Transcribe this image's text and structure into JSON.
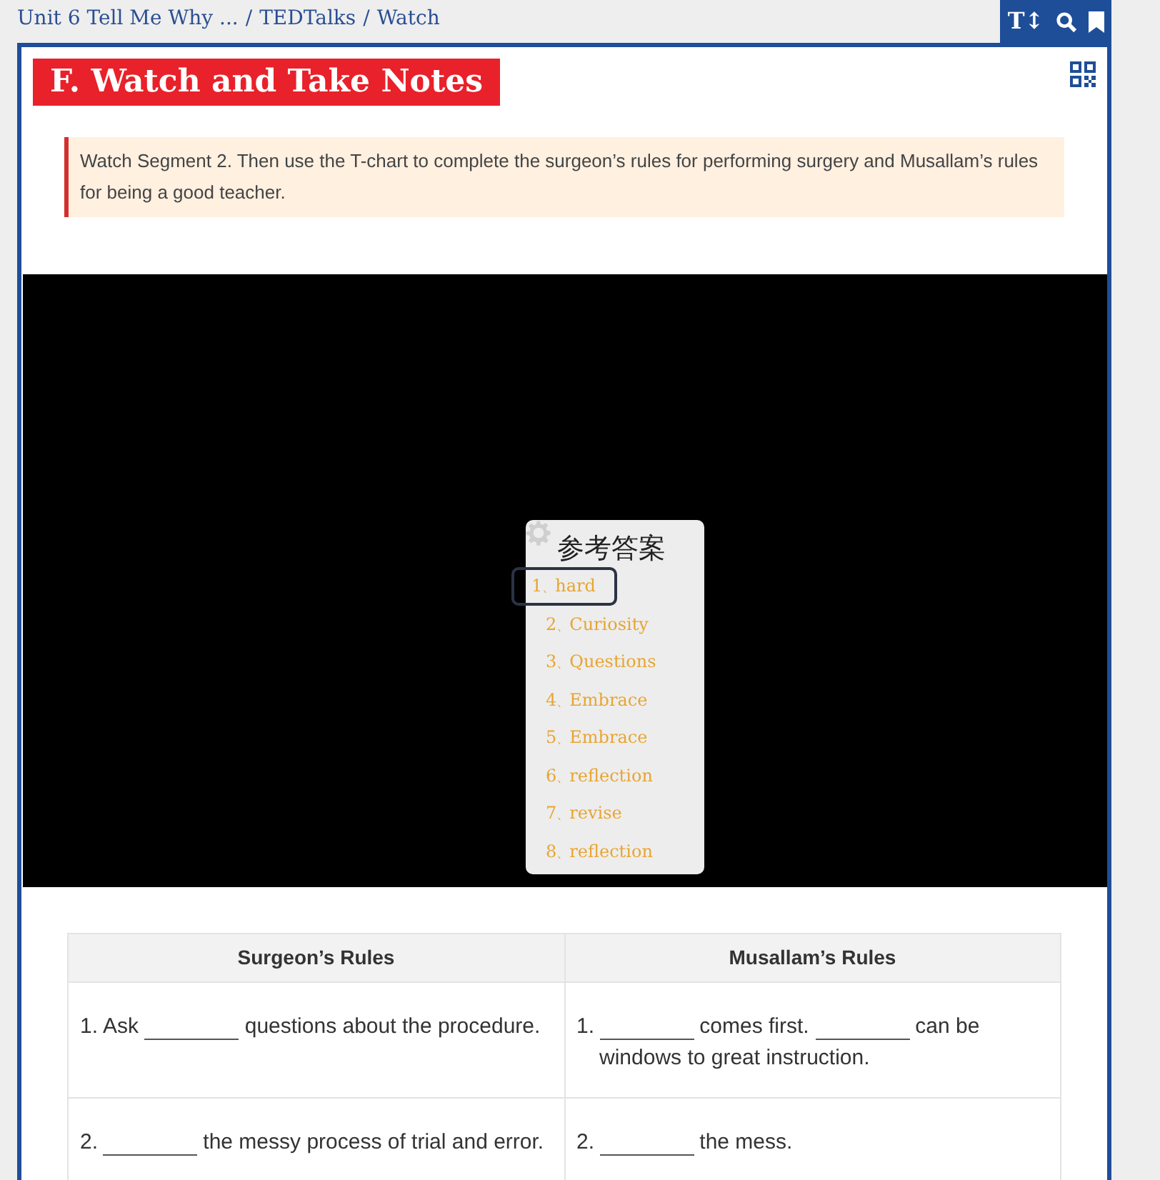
{
  "breadcrumb": [
    {
      "label": "Unit 6 Tell Me Why ..."
    },
    {
      "label": "TEDTalks"
    },
    {
      "label": "Watch"
    }
  ],
  "breadcrumb_separator": "/",
  "toolbar": {
    "text_size_button": "T↕"
  },
  "section_title": "F. Watch and Take Notes",
  "instruction": "Watch Segment 2. Then use the T-chart to complete the surgeon’s rules for performing surgery and Musallam’s rules for being a good teacher.",
  "answer_popup": {
    "title": "参考答案",
    "items": [
      {
        "number": "1",
        "answer": "hard",
        "selected": true
      },
      {
        "number": "2",
        "answer": "Curiosity",
        "selected": false
      },
      {
        "number": "3",
        "answer": "Questions",
        "selected": false
      },
      {
        "number": "4",
        "answer": "Embrace",
        "selected": false
      },
      {
        "number": "5",
        "answer": "Embrace",
        "selected": false
      },
      {
        "number": "6",
        "answer": "reflection",
        "selected": false
      },
      {
        "number": "7",
        "answer": "revise",
        "selected": false
      },
      {
        "number": "8",
        "answer": "reflection",
        "selected": false
      }
    ],
    "separator": "、"
  },
  "table": {
    "columns": [
      "Surgeon’s Rules",
      "Musallam’s Rules"
    ],
    "rows": [
      [
        {
          "number": "1.",
          "parts": [
            {
              "kind": "text",
              "text": "Ask "
            },
            {
              "kind": "blank"
            },
            {
              "kind": "text",
              "text": " questions about the procedure."
            }
          ]
        },
        {
          "number": "1.",
          "parts": [
            {
              "kind": "blank"
            },
            {
              "kind": "text",
              "text": " comes first. "
            },
            {
              "kind": "blank"
            },
            {
              "kind": "text",
              "text": " can be windows to great instruction."
            }
          ]
        }
      ],
      [
        {
          "number": "2.",
          "parts": [
            {
              "kind": "blank"
            },
            {
              "kind": "text",
              "text": " the messy process of trial and error."
            }
          ]
        },
        {
          "number": "2.",
          "parts": [
            {
              "kind": "blank"
            },
            {
              "kind": "text",
              "text": " the mess."
            }
          ]
        }
      ]
    ]
  }
}
